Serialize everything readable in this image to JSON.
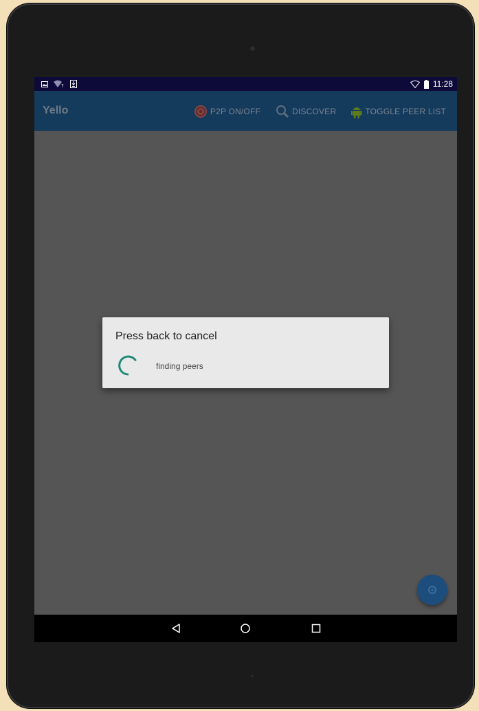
{
  "statusbar": {
    "left_icons": [
      "image-icon",
      "wifi-question-icon",
      "download-icon"
    ],
    "right_icons": [
      "wifi-icon",
      "battery-icon"
    ],
    "time": "11:28"
  },
  "appbar": {
    "title": "Yello",
    "actions": [
      {
        "label": "P2P ON/OFF",
        "icon": "p2p-toggle-icon"
      },
      {
        "label": "DISCOVER",
        "icon": "search-icon"
      },
      {
        "label": "TOGGLE PEER LIST",
        "icon": "android-icon"
      }
    ]
  },
  "dialog": {
    "title": "Press back to cancel",
    "message": "finding peers",
    "spinner_color": "#1f8a7a"
  },
  "fab": {
    "icon": "wifi-direct-icon"
  },
  "navbar": {
    "buttons": [
      "back-icon",
      "home-icon",
      "recents-icon"
    ]
  },
  "colors": {
    "statusbar": "#0d0a3a",
    "appbar": "#143a5c",
    "content_dim": "#555555",
    "fab": "#1c4d7d"
  }
}
